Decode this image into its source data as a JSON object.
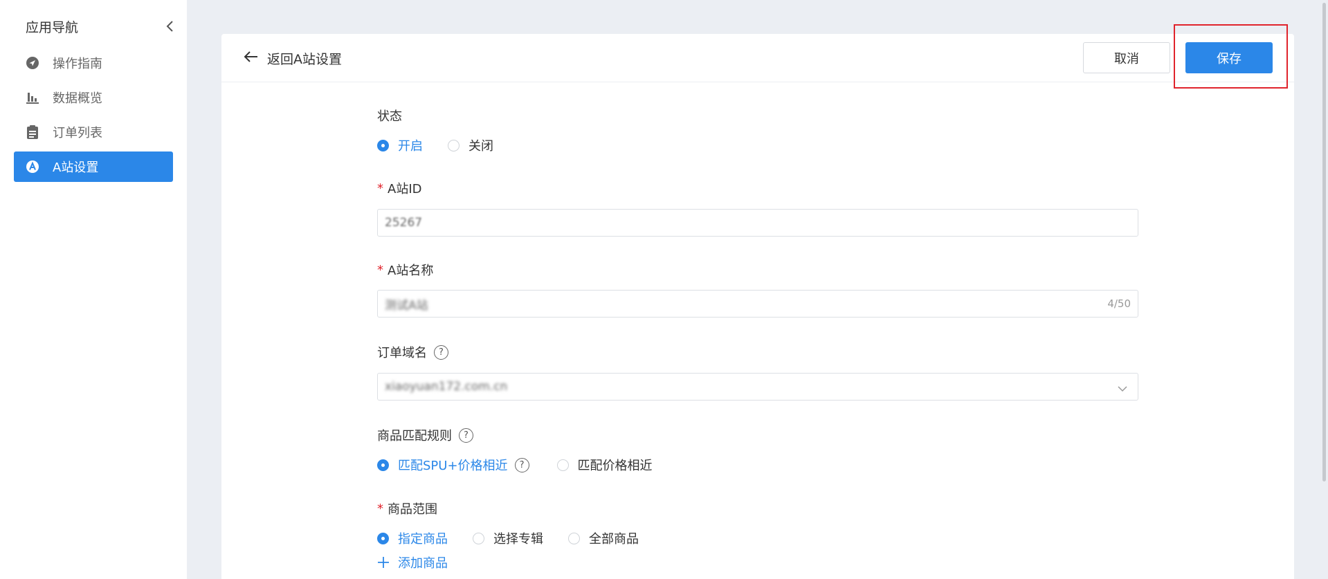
{
  "sidebar": {
    "title": "应用导航",
    "items": [
      {
        "label": "操作指南",
        "icon": "compass-icon"
      },
      {
        "label": "数据概览",
        "icon": "bar-chart-icon"
      },
      {
        "label": "订单列表",
        "icon": "clipboard-icon"
      },
      {
        "label": "A站设置",
        "icon": "a-badge-icon",
        "active": true
      }
    ]
  },
  "header": {
    "back_label": "返回A站设置",
    "cancel_label": "取消",
    "save_label": "保存"
  },
  "form": {
    "status": {
      "label": "状态",
      "options": [
        "开启",
        "关闭"
      ],
      "selected": "开启"
    },
    "site_id": {
      "label": "A站ID",
      "value": "25267"
    },
    "site_name": {
      "label": "A站名称",
      "value": "测试A站",
      "counter": "4/50"
    },
    "order_domain": {
      "label": "订单域名",
      "value": "xiaoyuan172.com.cn"
    },
    "match_rule": {
      "label": "商品匹配规则",
      "options": [
        "匹配SPU+价格相近",
        "匹配价格相近"
      ],
      "selected": "匹配SPU+价格相近"
    },
    "product_scope": {
      "label": "商品范围",
      "options": [
        "指定商品",
        "选择专辑",
        "全部商品"
      ],
      "selected": "指定商品"
    },
    "add_product_label": "添加商品"
  },
  "colors": {
    "accent": "#2b87e8",
    "required": "#e0232c",
    "background": "#ebeef3"
  }
}
